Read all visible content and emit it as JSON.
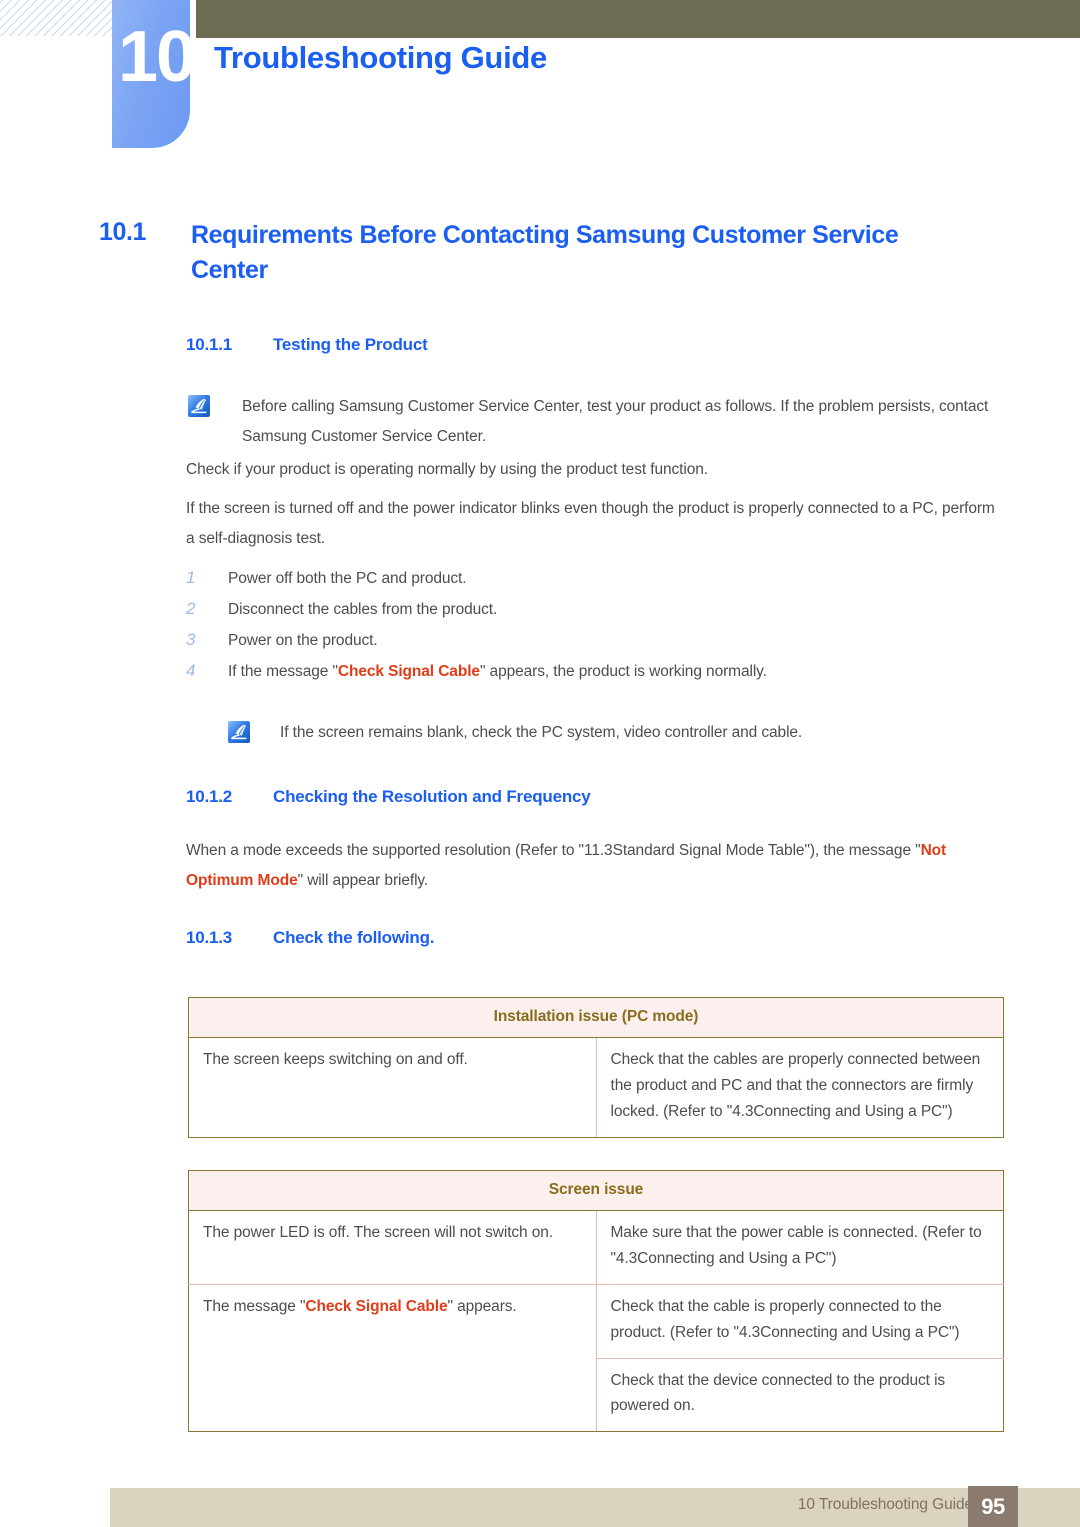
{
  "header": {
    "chapter_number": "10",
    "chapter_title": "Troubleshooting Guide",
    "accent_color": "#1a5ef2",
    "bar_color": "#6e6b53"
  },
  "section": {
    "number": "10.1",
    "title": "Requirements Before Contacting Samsung Customer Service Center"
  },
  "subsections": {
    "s1": {
      "number": "10.1.1",
      "title": "Testing the Product"
    },
    "s2": {
      "number": "10.1.2",
      "title": "Checking the Resolution and Frequency"
    },
    "s3": {
      "number": "10.1.3",
      "title": "Check the following."
    }
  },
  "notes": {
    "note1": "Before calling Samsung Customer Service Center, test your product as follows. If the problem persists, contact Samsung Customer Service Center.",
    "note2": "If the screen remains blank, check the PC system, video controller and cable.",
    "icon_name": "note-pen-icon"
  },
  "paragraphs": {
    "p1": "Check if your product is operating normally by using the product test function.",
    "p2": "If the screen is turned off and the power indicator blinks even though the product is properly connected to a PC, perform a self-diagnosis test.",
    "p3_part1": "When a mode exceeds the supported resolution (Refer to \"11.3Standard Signal Mode Table\"), the message \"",
    "p3_highlight": "Not Optimum Mode",
    "p3_part2": "\" will appear briefly."
  },
  "steps": [
    {
      "num": "1",
      "text": "Power off both the PC and product."
    },
    {
      "num": "2",
      "text": "Disconnect the cables from the product."
    },
    {
      "num": "3",
      "text": "Power on the product."
    },
    {
      "num": "4",
      "text_before": "If the message \"",
      "highlight": "Check Signal Cable",
      "text_after": "\" appears, the product is working normally."
    }
  ],
  "tables": [
    {
      "header": "Installation issue (PC mode)",
      "rows": [
        {
          "issue": "The screen keeps switching on and off.",
          "solutions": [
            "Check that the cables are properly connected between the product and PC and that the connectors are firmly locked. (Refer to \"4.3Connecting and Using a PC\")"
          ]
        }
      ]
    },
    {
      "header": "Screen issue",
      "rows": [
        {
          "issue": "The power LED is off. The screen will not switch on.",
          "solutions": [
            "Make sure that the power cable is connected. (Refer to \"4.3Connecting and Using a PC\")"
          ]
        },
        {
          "issue_before": "The message \"",
          "issue_highlight": "Check Signal Cable",
          "issue_after": "\" appears.",
          "solutions": [
            "Check that the cable is properly connected to the product. (Refer to \"4.3Connecting and Using a PC\")",
            "Check that the device connected to the product is powered on."
          ]
        }
      ]
    }
  ],
  "footer": {
    "text": "10 Troubleshooting Guide",
    "page": "95",
    "bar_color": "#dad3bf",
    "page_box_color": "#8a7b6e"
  },
  "colors": {
    "heading_blue": "#1a5ef2",
    "body_gray": "#4d4d4d",
    "highlight_red": "#e03c18",
    "table_header_bg": "#fbf0ee",
    "table_header_text": "#8a6d1c",
    "table_border": "#8a7633"
  }
}
